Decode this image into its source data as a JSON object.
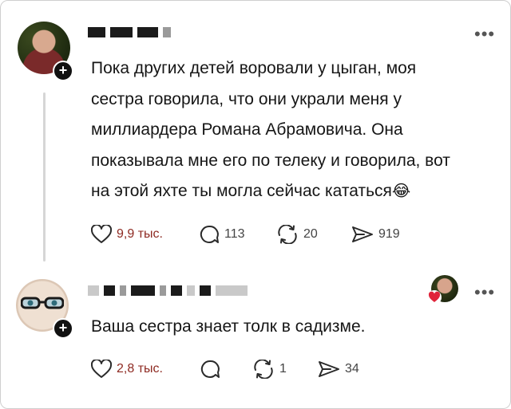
{
  "posts": [
    {
      "text": "Пока других детей воровали у цыган, моя\nсестра говорила, что они украли меня у\nмиллиардера Романа Абрамовича. Она\nпоказывала мне его по телеку и говорила, вот\nна этой яхте ты могла сейчас кататься",
      "emoji": "😂",
      "likes": "9,9 тыс.",
      "comments": "113",
      "reposts": "20",
      "shares": "919"
    },
    {
      "text": "Ваша сестра знает толк в садизме.",
      "likes": "2,8 тыс.",
      "comments": "",
      "reposts": "1",
      "shares": "34"
    }
  ],
  "icons": {
    "like": "heart-icon",
    "comment": "comment-bubble-icon",
    "repost": "repost-icon",
    "share": "send-icon",
    "more": "more-dots-icon",
    "follow": "plus-icon"
  },
  "colors": {
    "liked_count": "#8e2a22",
    "reply_heart": "#e0243a"
  }
}
